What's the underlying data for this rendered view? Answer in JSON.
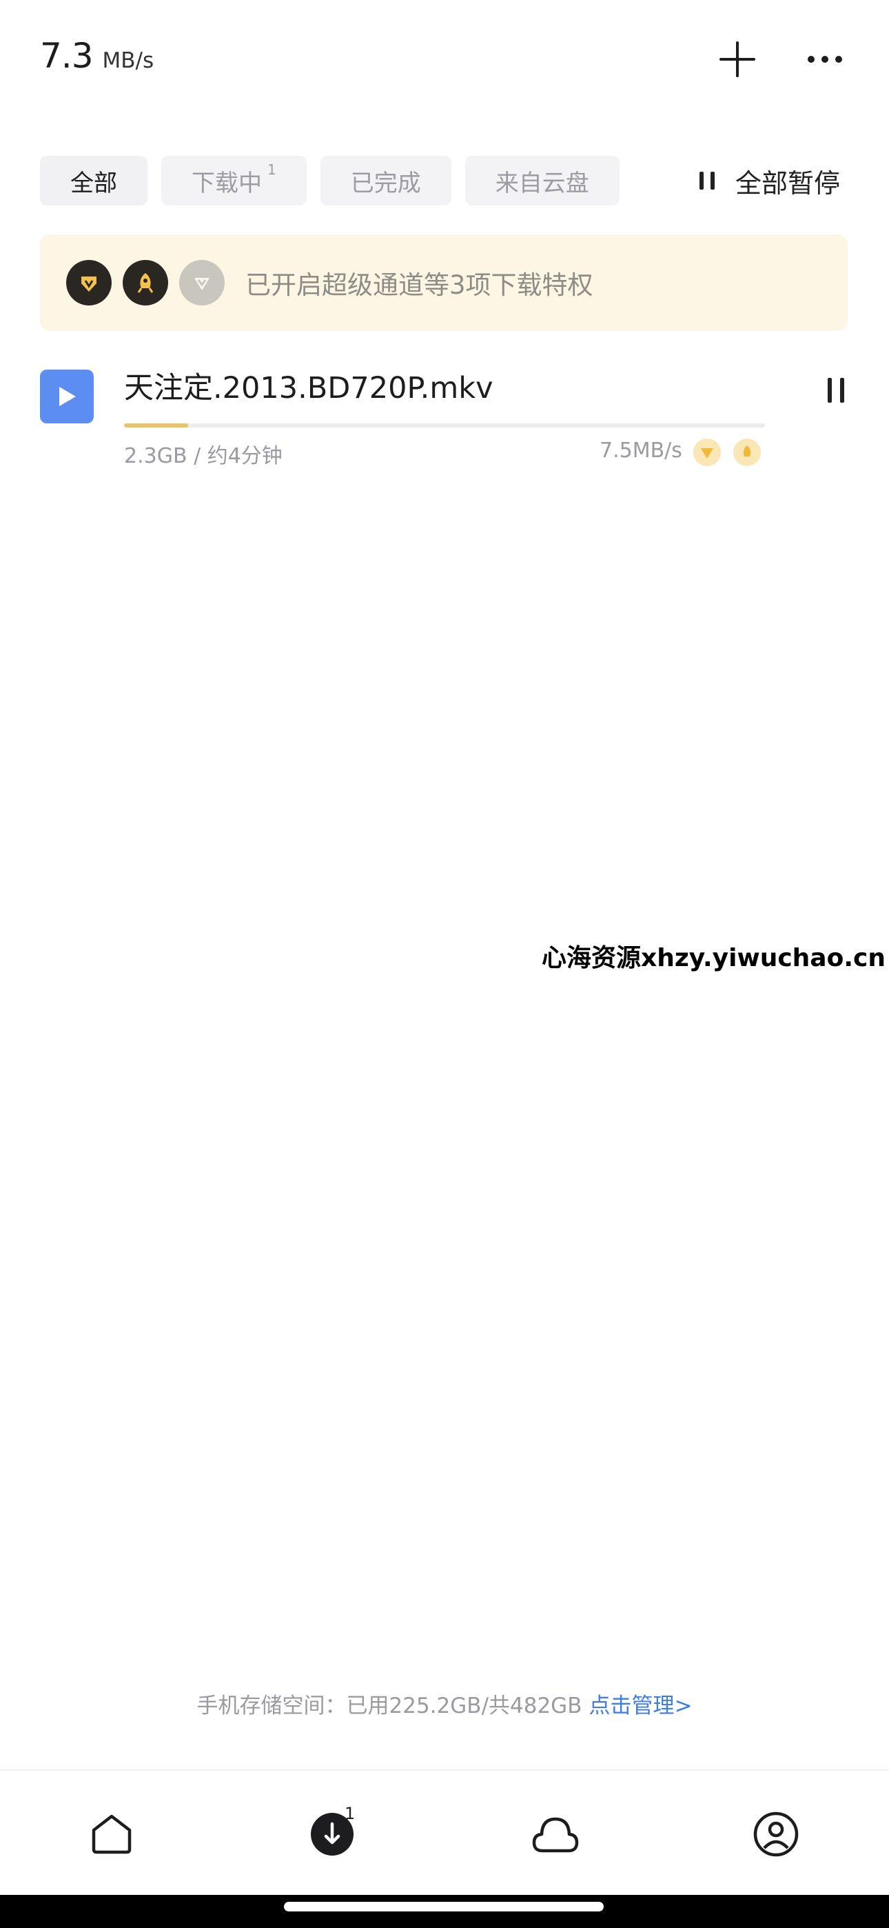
{
  "header": {
    "speed_value": "7.3",
    "speed_unit": "MB/s",
    "add_icon": "plus-icon",
    "more_icon": "more-horizontal-icon"
  },
  "tabs": [
    {
      "label": "全部",
      "count": "",
      "active": true
    },
    {
      "label": "下载中",
      "count": "1",
      "active": false
    },
    {
      "label": "已完成",
      "count": "",
      "active": false
    },
    {
      "label": "来自云盘",
      "count": "",
      "active": false
    }
  ],
  "pause_all": {
    "label": "全部暂停",
    "icon": "pause-icon"
  },
  "privilege_banner": {
    "text": "已开启超级通道等3项下载特权",
    "badges": [
      "diamond-badge-icon",
      "rocket-badge-icon",
      "diamond-badge-grey-icon"
    ],
    "bg_color": "#fdf6e5"
  },
  "download_item": {
    "file_name": "天注定.2013.BD720P.mkv",
    "meta": "2.3GB / 约4分钟",
    "speed": "7.5MB/s",
    "progress": 0.1,
    "progress_color": "#e9c26a",
    "icon": "video-file-icon"
  },
  "watermark": "心海资源xhzy.yiwuchao.cn",
  "storage": {
    "text": "手机存储空间：已用225.2GB/共482GB",
    "manage_link": "点击管理>"
  },
  "bottom_nav": {
    "items": [
      "home-icon",
      "download-icon",
      "cloud-icon",
      "profile-icon"
    ],
    "download_badge": "1"
  }
}
